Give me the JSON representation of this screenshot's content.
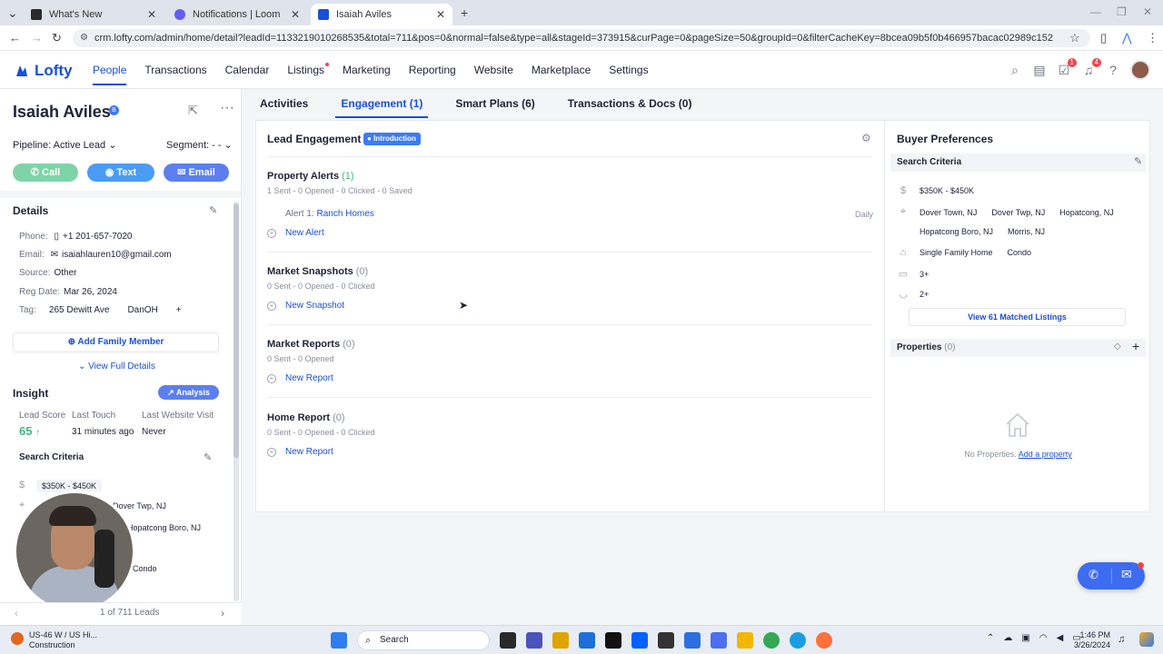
{
  "browser": {
    "tabs": [
      {
        "title": "What's New",
        "color": "#2b2b2b"
      },
      {
        "title": "Notifications | Loom",
        "color": "#625df5"
      },
      {
        "title": "Isaiah Aviles",
        "color": "#1a4fd8"
      }
    ],
    "url": "crm.lofty.com/admin/home/detail?leadId=1133219010268535&total=711&pos=0&normal=false&type=all&stageId=373915&curPage=0&pageSize=50&groupId=0&filterCacheKey=8bcea09b5f0b466957bacac02989c152"
  },
  "app": {
    "logo": "Lofty",
    "nav": [
      "People",
      "Transactions",
      "Calendar",
      "Listings",
      "Marketing",
      "Reporting",
      "Website",
      "Marketplace",
      "Settings"
    ],
    "badges": {
      "tasks": "1",
      "notifications": "4"
    }
  },
  "lead": {
    "name": "Isaiah Aviles",
    "name_badge": "B",
    "pipeline": "Pipeline: Active Lead",
    "segment": "Segment: - -",
    "actions": {
      "call": "Call",
      "text": "Text",
      "email": "Email"
    },
    "details_title": "Details",
    "phone_label": "Phone:",
    "phone": "+1 201-657-7020",
    "email_label": "Email:",
    "email": "isaiahlauren10@gmail.com",
    "source_label": "Source:",
    "source": "Other",
    "regdate_label": "Reg Date:",
    "regdate": "Mar 26, 2024",
    "tag_label": "Tag:",
    "tags": [
      "265 Dewitt Ave",
      "DanOH"
    ],
    "add_family": "Add Family Member",
    "view_full": "View Full Details",
    "insight_title": "Insight",
    "analysis": "Analysis",
    "insight_labels": [
      "Lead Score",
      "Last Touch",
      "Last Website Visit"
    ],
    "lead_score": "65",
    "last_touch": "31 minutes ago",
    "last_visit": "Never",
    "search_criteria_title": "Search Criteria",
    "sc_price": "$350K - $450K",
    "sc_loc1": "Dover Twp, NJ",
    "sc_loc2": "Hopatcong Boro, NJ",
    "sc_type": "Condo",
    "pager": "1 of 711 Leads"
  },
  "subtabs": [
    "Activities",
    "Engagement (1)",
    "Smart Plans (6)",
    "Transactions & Docs (0)"
  ],
  "engagement": {
    "title": "Lead Engagement",
    "badge": "Introduction",
    "alerts_title": "Property Alerts",
    "alerts_count": "(1)",
    "alerts_sub": "1 Sent - 0 Opened - 0 Clicked - 0 Saved",
    "alert_label": "Alert 1:",
    "alert_name": "Ranch Homes",
    "alert_freq": "Daily",
    "new_alert": "New Alert",
    "snap_title": "Market Snapshots",
    "snap_count": "(0)",
    "snap_sub": "0 Sent - 0 Opened - 0 Clicked",
    "new_snap": "New Snapshot",
    "reports_title": "Market Reports",
    "reports_count": "(0)",
    "reports_sub": "0 Sent - 0 Opened",
    "new_report": "New Report",
    "home_title": "Home Report",
    "home_count": "(0)",
    "home_sub": "0 Sent - 0 Opened - 0 Clicked",
    "new_home_report": "New Report"
  },
  "buyer": {
    "title": "Buyer Preferences",
    "sc_title": "Search Criteria",
    "price": "$350K - $450K",
    "locations": [
      "Dover Town, NJ",
      "Dover Twp, NJ",
      "Hopatcong, NJ",
      "Hopatcong Boro, NJ",
      "Morris, NJ"
    ],
    "types": [
      "Single Family Home",
      "Condo"
    ],
    "beds": "3+",
    "baths": "2+",
    "matched": "View 61 Matched Listings",
    "props_title": "Properties",
    "props_count": "(0)",
    "no_props": "No Properties.",
    "add_prop": "Add a property"
  },
  "taskbar": {
    "weather_line1": "US-46 W / US Hi...",
    "weather_line2": "Construction",
    "search": "Search",
    "time": "1:46 PM",
    "date": "3/26/2024"
  }
}
